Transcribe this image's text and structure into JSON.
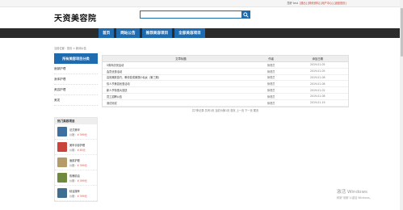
{
  "topbar": {
    "welcome": "您好 test",
    "links": "[退出] [修改资料] [用户中心] [返回首页]"
  },
  "logo": "天资美容院",
  "search": {
    "placeholder": ""
  },
  "nav": {
    "items": [
      {
        "label": "首页"
      },
      {
        "label": "网站公告"
      },
      {
        "label": "推荐美容项目"
      },
      {
        "label": "全部美容项目"
      }
    ]
  },
  "breadcrumb": "当前位置：首页 > 新闻公告",
  "sidebar": {
    "title": "所有美容项目分类",
    "categories": [
      {
        "label": "面部护理"
      },
      {
        "label": "身体护理"
      },
      {
        "label": "美容护理"
      },
      {
        "label": "美发"
      }
    ]
  },
  "hot": {
    "title": "热门美容项目",
    "price_label": "价格：",
    "products": [
      {
        "name": "法式美甲",
        "price": "¥ 399元",
        "color": "#3d6fa0"
      },
      {
        "name": "美甲手部护理",
        "price": "¥ 85元",
        "color": "#c9453b"
      },
      {
        "name": "面部护理",
        "price": "¥ 399元",
        "color": "#b59a6a"
      },
      {
        "name": "玫瑰精油",
        "price": "¥ 399元",
        "color": "#6f8a3c"
      },
      {
        "name": "精油按摩",
        "price": "¥ 399元",
        "color": "#3f6e90"
      }
    ]
  },
  "table": {
    "headers": {
      "title": "文章标题",
      "author": "作者",
      "date": "添加日期"
    },
    "rows": [
      {
        "title": "5周年庆祝活动",
        "author": "管理员",
        "date": "2019-01-05"
      },
      {
        "title": "会员优惠活动",
        "author": "管理员",
        "date": "2019-01-05"
      },
      {
        "title": "高效美肤技巧，教你变成美丽小仙女（第三期）",
        "author": "管理员",
        "date": "2019-01-08"
      },
      {
        "title": "情人节美容优惠活动",
        "author": "管理员",
        "date": "2019-01-08"
      },
      {
        "title": "新人节特惠大放送",
        "author": "管理员",
        "date": "2019-01-02"
      },
      {
        "title": "员工招聘公告",
        "author": "管理员",
        "date": "2019-01-08"
      },
      {
        "title": "测试测试",
        "author": "管理员",
        "date": "2019-01-19"
      }
    ]
  },
  "pager": "共7条记录  共有1页  当前为第1页  首页  上一页  下一页  尾页",
  "watermark": {
    "line1": "激活 Windows",
    "line2": "转到\"设置\"以激活 Windows。"
  }
}
